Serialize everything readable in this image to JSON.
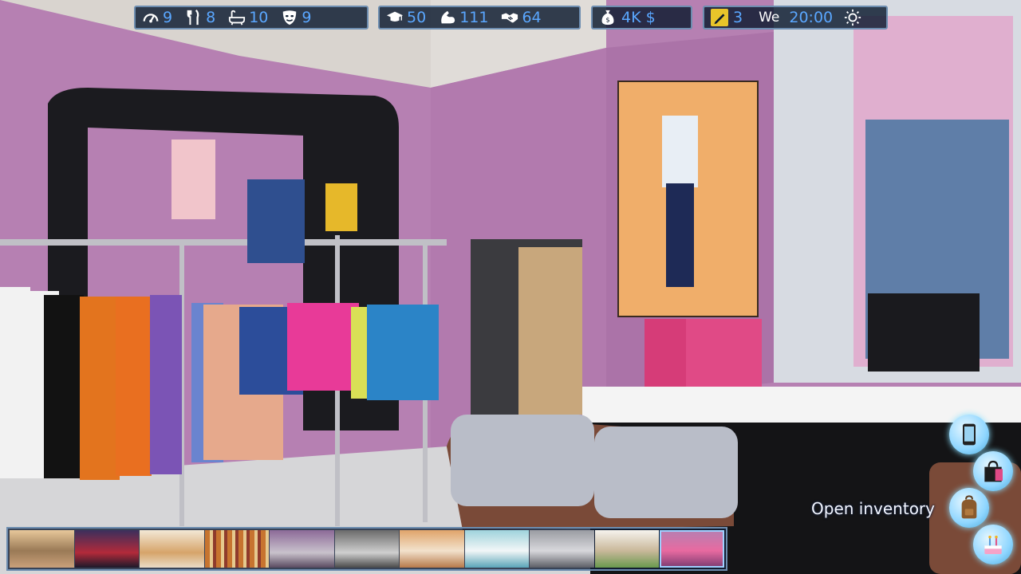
{
  "hud": {
    "needs": [
      {
        "icon": "energy-gauge-icon",
        "value": "9"
      },
      {
        "icon": "fork-knife-icon",
        "value": "8"
      },
      {
        "icon": "bathtub-icon",
        "value": "10"
      },
      {
        "icon": "mask-icon",
        "value": "9"
      }
    ],
    "skills": [
      {
        "icon": "graduation-cap-icon",
        "value": "50"
      },
      {
        "icon": "muscle-arm-icon",
        "value": "111"
      },
      {
        "icon": "handshake-icon",
        "value": "64"
      }
    ],
    "money": {
      "icon": "money-bag-icon",
      "value": "4K $"
    },
    "time": {
      "icon": "notepad-icon",
      "count": "3",
      "day": "We",
      "clock": "20:00",
      "weather_icon": "sun-icon"
    }
  },
  "tooltip": "Open inventory",
  "side_buttons": [
    {
      "name": "phone",
      "icon": "phone-icon"
    },
    {
      "name": "shopping",
      "icon": "shopping-bag-icon"
    },
    {
      "name": "inventory",
      "icon": "backpack-icon"
    },
    {
      "name": "cake",
      "icon": "cake-icon"
    }
  ],
  "location_strip": [
    {
      "name": "mall-lobby"
    },
    {
      "name": "arcade"
    },
    {
      "name": "bakery"
    },
    {
      "name": "bookstore"
    },
    {
      "name": "shop-counter"
    },
    {
      "name": "gym"
    },
    {
      "name": "furniture-store"
    },
    {
      "name": "pharmacy"
    },
    {
      "name": "hallway"
    },
    {
      "name": "cafe"
    },
    {
      "name": "clothing-store"
    }
  ],
  "colors": {
    "hud_value": "#5aa7ff",
    "hud_border": "#6d8db0",
    "wall": "#b77fb3"
  }
}
